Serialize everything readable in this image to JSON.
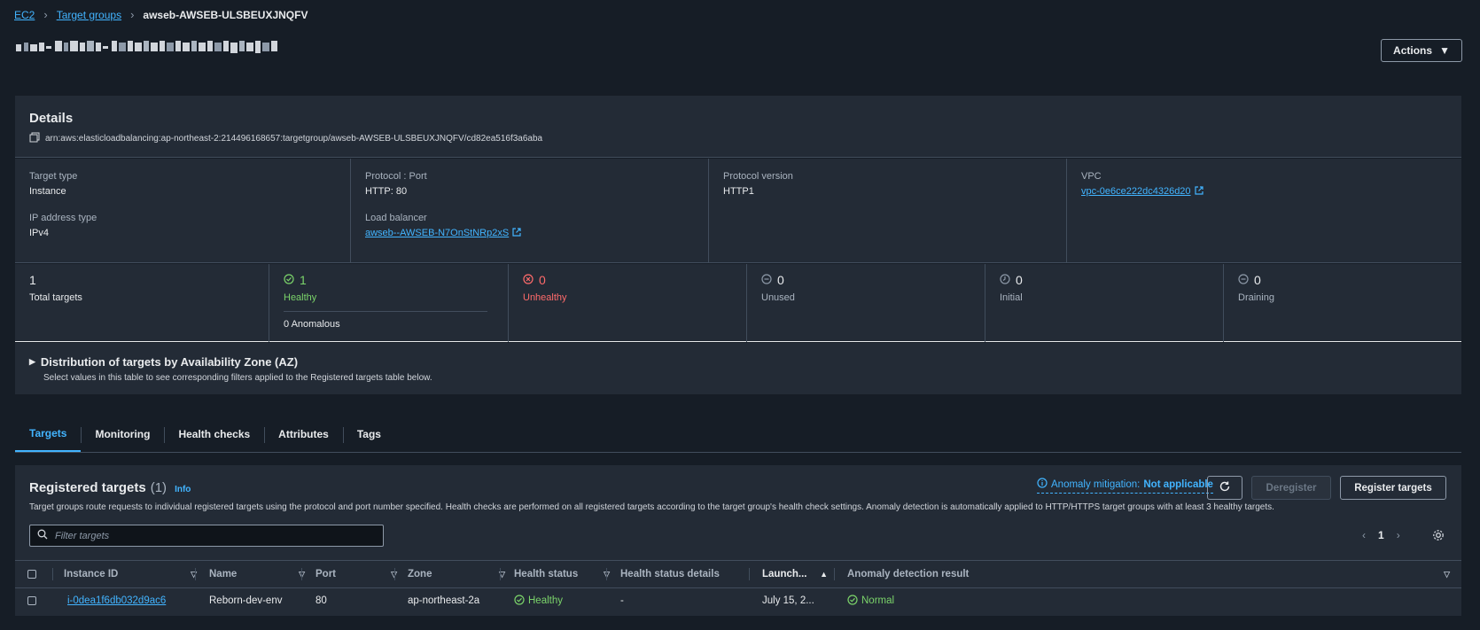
{
  "breadcrumb": {
    "ec2": "EC2",
    "target_groups": "Target groups",
    "current": "awseb-AWSEB-ULSBEUXJNQFV"
  },
  "header": {
    "actions_label": "Actions"
  },
  "details": {
    "title": "Details",
    "arn": "arn:aws:elasticloadbalancing:ap-northeast-2:214496168657:targetgroup/awseb-AWSEB-ULSBEUXJNQFV/cd82ea516f3a6aba",
    "target_type_label": "Target type",
    "target_type": "Instance",
    "ip_type_label": "IP address type",
    "ip_type": "IPv4",
    "protocol_port_label": "Protocol : Port",
    "protocol_port": "HTTP: 80",
    "load_balancer_label": "Load balancer",
    "load_balancer": "awseb--AWSEB-N7OnStNRp2xS",
    "protocol_version_label": "Protocol version",
    "protocol_version": "HTTP1",
    "vpc_label": "VPC",
    "vpc": "vpc-0e6ce222dc4326d20"
  },
  "counts": {
    "total": "1",
    "total_label": "Total targets",
    "healthy": "1",
    "healthy_label": "Healthy",
    "anomalous": "0 Anomalous",
    "unhealthy": "0",
    "unhealthy_label": "Unhealthy",
    "unused": "0",
    "unused_label": "Unused",
    "initial": "0",
    "initial_label": "Initial",
    "draining": "0",
    "draining_label": "Draining"
  },
  "distribution": {
    "title": "Distribution of targets by Availability Zone (AZ)",
    "subtitle": "Select values in this table to see corresponding filters applied to the Registered targets table below."
  },
  "tabs": [
    "Targets",
    "Monitoring",
    "Health checks",
    "Attributes",
    "Tags"
  ],
  "registered": {
    "title": "Registered targets",
    "count": "(1)",
    "info": "Info",
    "description": "Target groups route requests to individual registered targets using the protocol and port number specified. Health checks are performed on all registered targets according to the target group's health check settings. Anomaly detection is automatically applied to HTTP/HTTPS target groups with at least 3 healthy targets.",
    "mitigation_label": "Anomaly mitigation:",
    "mitigation_value": "Not applicable",
    "deregister_label": "Deregister",
    "register_label": "Register targets",
    "filter_placeholder": "Filter targets",
    "page": "1",
    "columns": {
      "instance_id": "Instance ID",
      "name": "Name",
      "port": "Port",
      "zone": "Zone",
      "health_status": "Health status",
      "health_details": "Health status details",
      "launch": "Launch...",
      "anomaly": "Anomaly detection result"
    },
    "rows": [
      {
        "instance_id": "i-0dea1f6db032d9ac6",
        "name": "Reborn-dev-env",
        "port": "80",
        "zone": "ap-northeast-2a",
        "health_status": "Healthy",
        "health_details": "-",
        "launch": "July 15, 2...",
        "anomaly": "Normal"
      }
    ]
  },
  "colors": {
    "accent": "#42b4ff",
    "healthy": "#7bd46a",
    "unhealthy": "#ff6b6b",
    "bg": "#161d26",
    "panel": "#232b36"
  }
}
